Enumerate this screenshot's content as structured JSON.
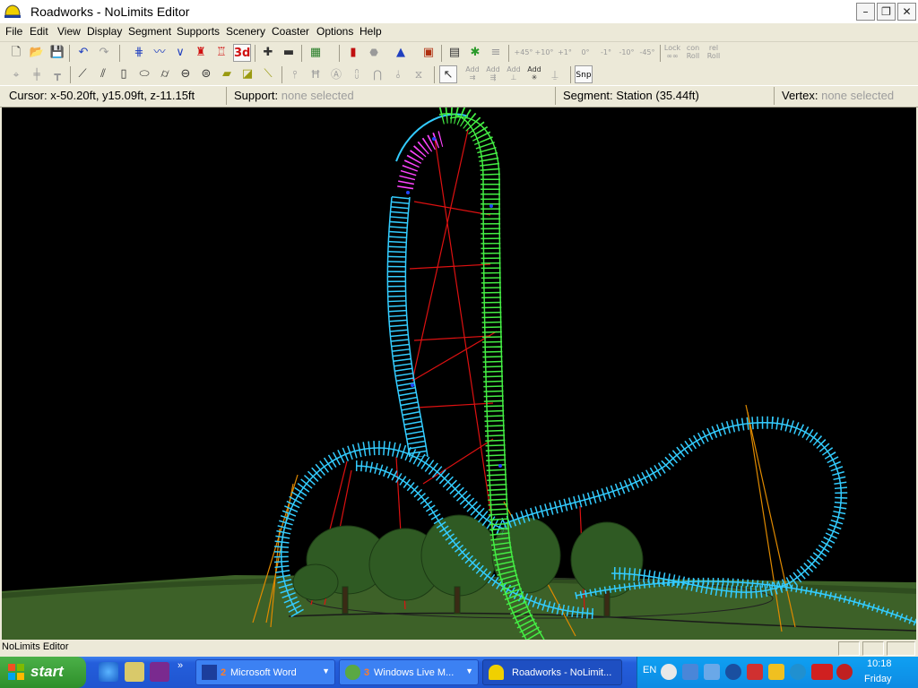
{
  "window": {
    "title": "Roadworks - NoLimits Editor",
    "icon": "roadworks-hardhat-icon"
  },
  "menu": [
    "File",
    "Edit",
    "View",
    "Display",
    "Segment",
    "Supports",
    "Scenery",
    "Coaster",
    "Options",
    "Help"
  ],
  "toolbar1": {
    "lock_label": "Lock",
    "con_label": "con",
    "rel_label": "rel",
    "roll_label": "Roll",
    "angles": [
      "+45°",
      "+10°",
      "+1°",
      "0°",
      "-1°",
      "-10°",
      "-45°"
    ],
    "view3d_label": "3d"
  },
  "toolbar2": {
    "snap_label": "Snp",
    "add_label": "Add"
  },
  "statusbar": {
    "cursor_label": "Cursor:",
    "cursor_value": "x-50.20ft, y15.09ft, z-11.15ft",
    "support_label": "Support:",
    "support_value": "none selected",
    "segment_label": "Segment:",
    "segment_value": "Station (35.44ft)",
    "vertex_label": "Vertex:",
    "vertex_value": "none selected"
  },
  "editor_status": "NoLimits Editor",
  "taskbar": {
    "start_label": "start",
    "items": [
      {
        "count": "2",
        "label": "Microsoft Word"
      },
      {
        "count": "3",
        "label": "Windows Live M..."
      },
      {
        "count": "",
        "label": "Roadworks - NoLimit..."
      }
    ],
    "language": "EN",
    "time": "10:18",
    "day": "Friday"
  },
  "colors": {
    "track_blue": "#33ccff",
    "track_green": "#44ee44",
    "track_magenta": "#ff44ff",
    "support_red": "#dd1111",
    "support_orange": "#e08a00",
    "ground": "#3d6128"
  }
}
